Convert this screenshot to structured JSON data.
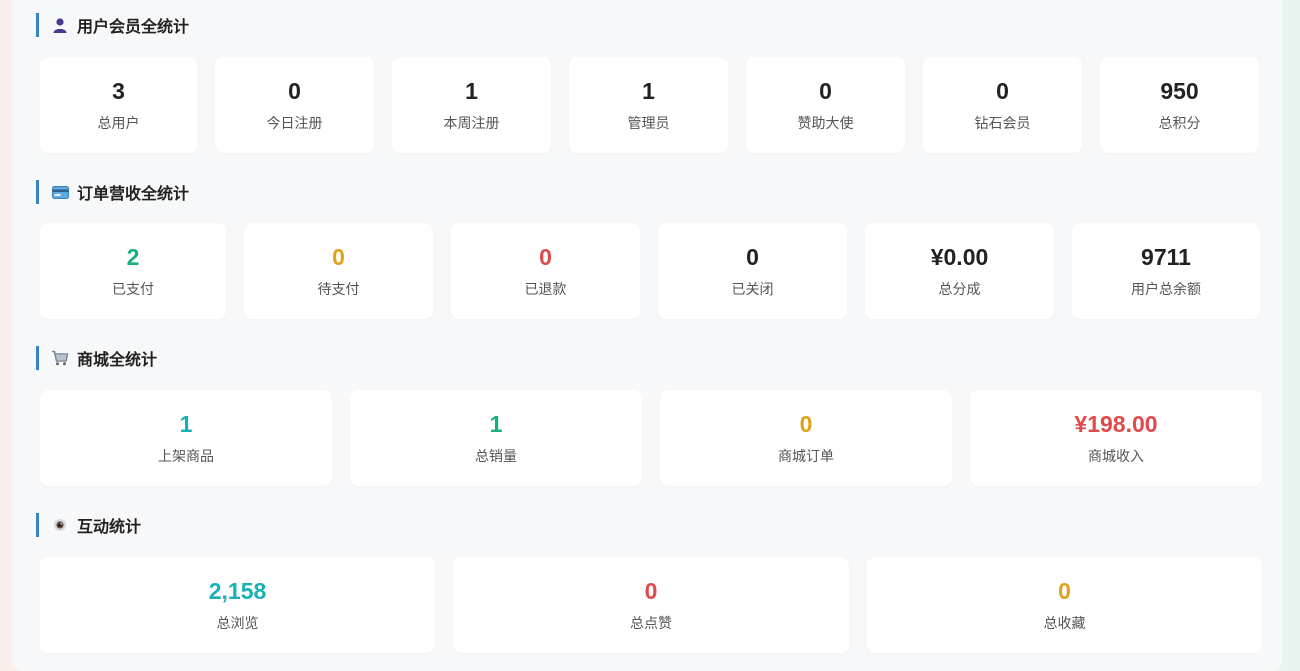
{
  "colors": {
    "dark": "#222222",
    "green": "#17b07a",
    "amber": "#e0a11b",
    "red": "#e04a4a",
    "teal": "#18b2b6",
    "accent_bar": "#3b82c4"
  },
  "sections": {
    "members": {
      "title": "用户会员全统计",
      "icon": "user-icon",
      "cards": [
        {
          "value": "3",
          "label": "总用户",
          "color": "dark"
        },
        {
          "value": "0",
          "label": "今日注册",
          "color": "dark"
        },
        {
          "value": "1",
          "label": "本周注册",
          "color": "dark"
        },
        {
          "value": "1",
          "label": "管理员",
          "color": "dark"
        },
        {
          "value": "0",
          "label": "赞助大使",
          "color": "dark"
        },
        {
          "value": "0",
          "label": "钻石会员",
          "color": "dark"
        },
        {
          "value": "950",
          "label": "总积分",
          "color": "dark"
        }
      ]
    },
    "orders": {
      "title": "订单营收全统计",
      "icon": "credit-card-icon",
      "cards": [
        {
          "value": "2",
          "label": "已支付",
          "color": "green"
        },
        {
          "value": "0",
          "label": "待支付",
          "color": "amber"
        },
        {
          "value": "0",
          "label": "已退款",
          "color": "red"
        },
        {
          "value": "0",
          "label": "已关闭",
          "color": "dark"
        },
        {
          "value": "¥0.00",
          "label": "总分成",
          "color": "dark"
        },
        {
          "value": "9711",
          "label": "用户总余额",
          "color": "dark"
        }
      ]
    },
    "shop": {
      "title": "商城全统计",
      "icon": "shopping-cart-icon",
      "cards": [
        {
          "value": "1",
          "label": "上架商品",
          "color": "teal"
        },
        {
          "value": "1",
          "label": "总销量",
          "color": "green"
        },
        {
          "value": "0",
          "label": "商城订单",
          "color": "amber"
        },
        {
          "value": "¥198.00",
          "label": "商城收入",
          "color": "red"
        }
      ]
    },
    "interaction": {
      "title": "互动统计",
      "icon": "eye-icon",
      "cards": [
        {
          "value": "2,158",
          "label": "总浏览",
          "color": "teal"
        },
        {
          "value": "0",
          "label": "总点赞",
          "color": "red"
        },
        {
          "value": "0",
          "label": "总收藏",
          "color": "amber"
        }
      ]
    }
  }
}
